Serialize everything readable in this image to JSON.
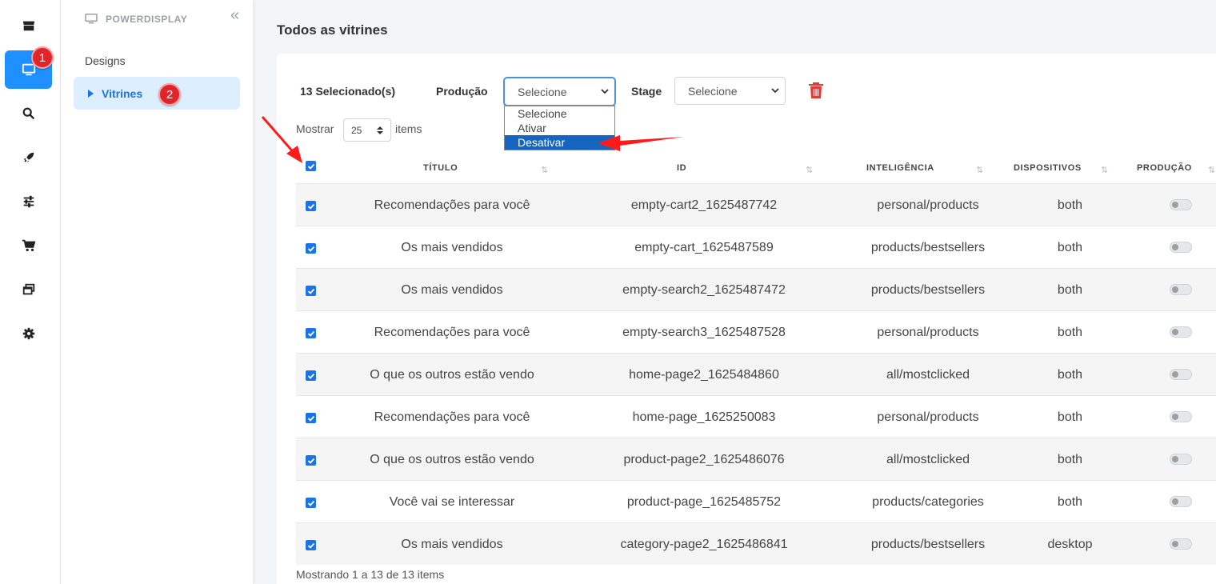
{
  "rail": {
    "items": [
      {
        "icon": "store-icon"
      },
      {
        "icon": "monitor-icon",
        "active": true
      },
      {
        "icon": "search-icon"
      },
      {
        "icon": "rocket-icon"
      },
      {
        "icon": "sliders-icon"
      },
      {
        "icon": "cart-icon"
      },
      {
        "icon": "windows-icon"
      },
      {
        "icon": "gear-icon"
      }
    ],
    "badge1": "1"
  },
  "subnav": {
    "section": "POWERDISPLAY",
    "designs": "Designs",
    "vitrines": "Vitrines",
    "badge2": "2"
  },
  "page": {
    "title": "Todos as vitrines"
  },
  "toolbar": {
    "selected_count": "13 Selecionado(s)",
    "producao_label": "Produção",
    "producao_value": "Selecione",
    "stage_label": "Stage",
    "stage_value": "Selecione",
    "dropdown_options": [
      "Selecione",
      "Ativar",
      "Desativar"
    ],
    "dropdown_highlight": "Desativar",
    "danger_color": "#e53935"
  },
  "pager": {
    "show_label": "Mostrar",
    "page_size": "25",
    "items_label": "items",
    "footer": "Mostrando 1 a 13 de 13 items"
  },
  "table": {
    "headers": [
      "TÍTULO",
      "ID",
      "INTELIGÊNCIA",
      "DISPOSITIVOS",
      "PRODUÇÃO"
    ],
    "rows": [
      {
        "titulo": "Recomendações para você",
        "id": "empty-cart2_1625487742",
        "inteligencia": "personal/products",
        "dispositivos": "both",
        "producao": false,
        "selected": true
      },
      {
        "titulo": "Os mais vendidos",
        "id": "empty-cart_1625487589",
        "inteligencia": "products/bestsellers",
        "dispositivos": "both",
        "producao": false,
        "selected": true
      },
      {
        "titulo": "Os mais vendidos",
        "id": "empty-search2_1625487472",
        "inteligencia": "products/bestsellers",
        "dispositivos": "both",
        "producao": false,
        "selected": true
      },
      {
        "titulo": "Recomendações para você",
        "id": "empty-search3_1625487528",
        "inteligencia": "personal/products",
        "dispositivos": "both",
        "producao": false,
        "selected": true
      },
      {
        "titulo": "O que os outros estão vendo",
        "id": "home-page2_1625484860",
        "inteligencia": "all/mostclicked",
        "dispositivos": "both",
        "producao": false,
        "selected": true
      },
      {
        "titulo": "Recomendações para você",
        "id": "home-page_1625250083",
        "inteligencia": "personal/products",
        "dispositivos": "both",
        "producao": false,
        "selected": true
      },
      {
        "titulo": "O que os outros estão vendo",
        "id": "product-page2_1625486076",
        "inteligencia": "all/mostclicked",
        "dispositivos": "both",
        "producao": false,
        "selected": true
      },
      {
        "titulo": "Você vai se interessar",
        "id": "product-page_1625485752",
        "inteligencia": "products/categories",
        "dispositivos": "both",
        "producao": false,
        "selected": true
      },
      {
        "titulo": "Os mais vendidos",
        "id": "category-page2_1625486841",
        "inteligencia": "products/bestsellers",
        "dispositivos": "desktop",
        "producao": false,
        "selected": true
      }
    ]
  },
  "colors": {
    "accent": "#1a73e8",
    "rail_active": "#1e90ff",
    "badge": "#e0242a",
    "annotation_arrow": "#ff1a1a"
  }
}
